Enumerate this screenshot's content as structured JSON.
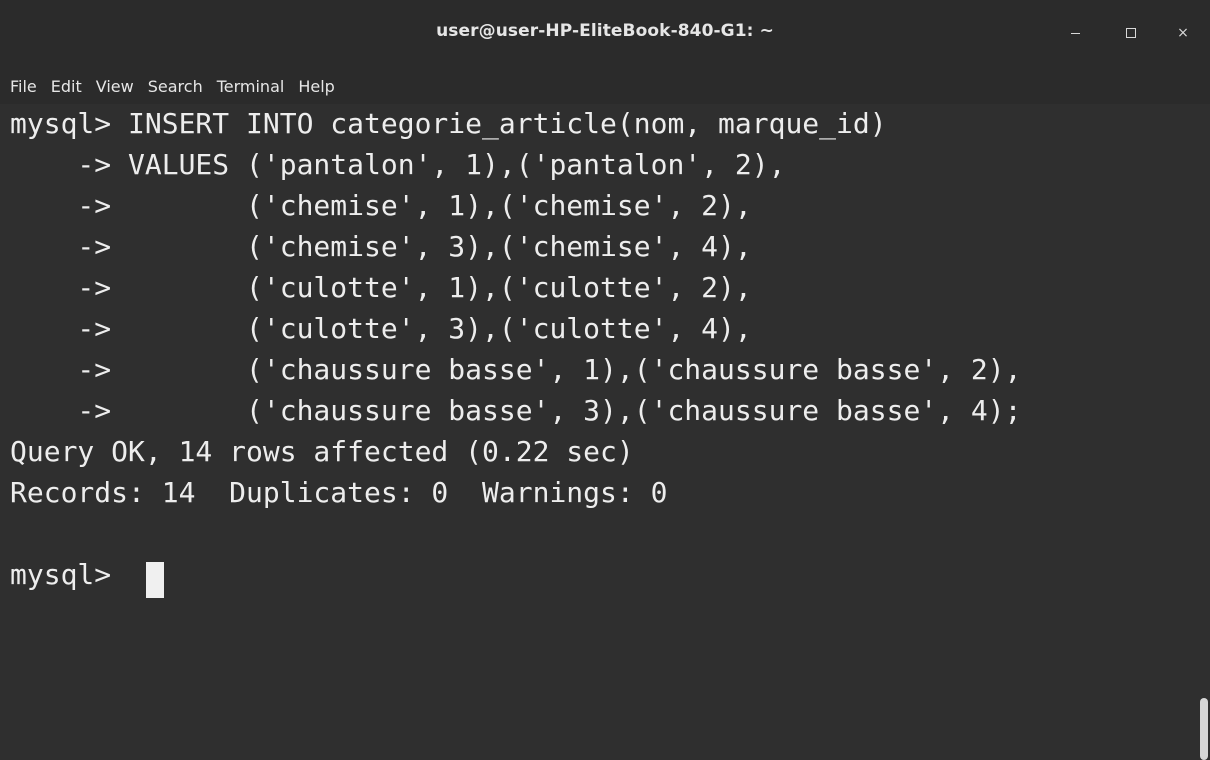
{
  "window": {
    "title": "user@user-HP-EliteBook-840-G1: ~",
    "controls": {
      "minimize_icon": "minimize-icon",
      "maximize_icon": "maximize-icon",
      "close_label": "×"
    }
  },
  "menu": {
    "items": [
      "File",
      "Edit",
      "View",
      "Search",
      "Terminal",
      "Help"
    ]
  },
  "terminal": {
    "lines": [
      "mysql> INSERT INTO categorie_article(nom, marque_id)",
      "    -> VALUES ('pantalon', 1),('pantalon', 2),",
      "    ->        ('chemise', 1),('chemise', 2),",
      "    ->        ('chemise', 3),('chemise', 4),",
      "    ->        ('culotte', 1),('culotte', 2),",
      "    ->        ('culotte', 3),('culotte', 4),",
      "    ->        ('chaussure basse', 1),('chaussure basse', 2),",
      "    ->        ('chaussure basse', 3),('chaussure basse', 4);",
      "Query OK, 14 rows affected (0.22 sec)",
      "Records: 14  Duplicates: 0  Warnings: 0",
      "",
      "mysql> "
    ]
  },
  "colors": {
    "background": "#2f2f2f",
    "titlebar": "#2b2b2b",
    "text": "#ededed"
  }
}
